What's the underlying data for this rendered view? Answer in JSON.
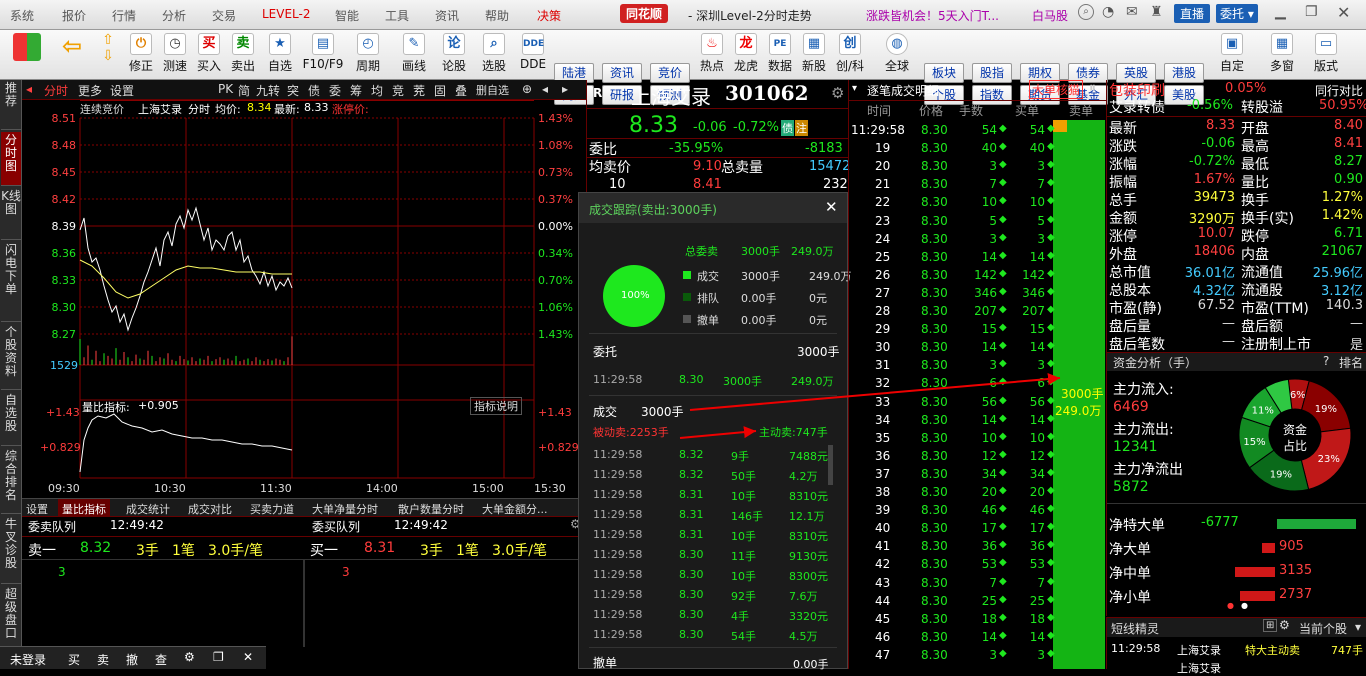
{
  "menubar": {
    "items": [
      "系统",
      "报价",
      "行情",
      "分析",
      "交易",
      "LEVEL-2",
      "智能",
      "工具",
      "资讯",
      "帮助",
      "决策"
    ],
    "logo": "同花顺",
    "title": "- 深圳Level-2分时走势",
    "promo": "涨跌皆机会！5天入门T...",
    "horse": "白马股",
    "btn_live": "直播",
    "btn_entrust": "委托"
  },
  "toolbar": {
    "buttons": [
      "修正",
      "测速",
      "买入",
      "卖出",
      "自选",
      "F10/F9",
      "周期",
      "画线",
      "论股",
      "选股",
      "DDE"
    ],
    "buttons2": [
      "热点",
      "龙虎",
      "数据",
      "新股",
      "创/科",
      "全球"
    ],
    "small_top": [
      "陆港",
      "资讯",
      "竞价"
    ],
    "small_bot": [
      "两融",
      "研报",
      "预测"
    ],
    "small2_top": [
      "板块",
      "股指",
      "期权",
      "债券",
      "英股",
      "港股"
    ],
    "small2_bot": [
      "个股",
      "指数",
      "期货",
      "基金",
      "外汇",
      "美股"
    ],
    "right": [
      "自定",
      "多窗",
      "版式"
    ]
  },
  "lefttabs": [
    "推荐",
    "分时图",
    "K线图",
    "闪电下单",
    "个股资料",
    "自选股",
    "综合排名",
    "牛叉诊股",
    "超级盘口"
  ],
  "chart": {
    "tabs": [
      "分时",
      "更多",
      "设置"
    ],
    "icons": [
      "PK",
      "简",
      "九转",
      "突",
      "债",
      "委",
      "筹",
      "均",
      "竞",
      "茺",
      "固",
      "叠",
      "删自选"
    ],
    "info": {
      "prefix": "连续竞价",
      "name": "上海艾录",
      "label_ptype": "分时",
      "avg_label": "均价:",
      "avg": "8.34",
      "latest_label": "最新:",
      "latest": "8.33",
      "limit": "涨停价:"
    },
    "y_left": [
      "8.51",
      "8.48",
      "8.45",
      "8.42",
      "8.39",
      "8.36",
      "8.33",
      "8.30",
      "8.27"
    ],
    "y_right": [
      "1.43%",
      "1.08%",
      "0.73%",
      "0.37%",
      "0.00%",
      "0.34%",
      "0.70%",
      "1.06%",
      "1.43%"
    ],
    "vol_label": "1529",
    "ratio_title": "量比指标:",
    "ratio_val": "+0.905",
    "ratio_help": "指标说明",
    "ratio_left": [
      "+1.43",
      "+0.829"
    ],
    "ratio_right": [
      "+1.43",
      "+0.829"
    ],
    "x_labels": [
      "09:30",
      "10:30",
      "11:30",
      "14:00",
      "15:00",
      "15:30"
    ],
    "bottom_tabs": [
      "设置",
      "量比指标",
      "成交统计",
      "成交对比",
      "买卖力道",
      "大单净量分时",
      "散户数量分时",
      "大单金额分..."
    ]
  },
  "queue": {
    "sell_title": "委卖队列",
    "sell_time": "12:49:42",
    "buy_title": "委买队列",
    "buy_time": "12:49:42",
    "sell": {
      "name": "卖一",
      "price": "8.32",
      "vol": "3手",
      "cnt": "1笔",
      "avg": "3.0手/笔",
      "item": "3"
    },
    "buy": {
      "name": "买一",
      "price": "8.31",
      "vol": "3手",
      "cnt": "1笔",
      "avg": "3.0手/笔",
      "item": "3"
    }
  },
  "statusbar": [
    "未登录",
    "买",
    "卖",
    "撤",
    "查"
  ],
  "quote": {
    "market": "R",
    "name": "上海艾录",
    "code": "301062",
    "price": "8.33",
    "change": "-0.06",
    "pct": "-0.72%",
    "tag1": "债",
    "tag2": "注",
    "wb_label": "委比",
    "wb": "-35.95%",
    "wc": "-8183",
    "avg_label": "均卖价",
    "avg": "9.10",
    "tot_label": "总卖量",
    "tot": "15472",
    "row_a": "10",
    "row_b": "8.41",
    "row_c": "232"
  },
  "popup": {
    "title": "成交跟踪(卖出:3000手)",
    "pie_label": "100%",
    "total_label": "总委卖",
    "total_vol": "3000手",
    "total_amt": "249.0万",
    "legend": [
      {
        "name": "成交",
        "vol": "3000手",
        "amt": "249.0万",
        "color": "#1ee81e"
      },
      {
        "name": "排队",
        "vol": "0.00手",
        "amt": "0元",
        "color": "#0a5a0a"
      },
      {
        "name": "撤单",
        "vol": "0.00手",
        "amt": "0元",
        "color": "#555555"
      }
    ],
    "entrust_label": "委托",
    "entrust_vol": "3000手",
    "entrust_row": {
      "time": "11:29:58",
      "price": "8.30",
      "vol": "3000手",
      "amt": "249.0万"
    },
    "deal_label": "成交",
    "deal_vol": "3000手",
    "passive": "被动卖:2253手",
    "active": "主动卖:747手",
    "rows": [
      {
        "time": "11:29:58",
        "price": "8.32",
        "vol": "9手",
        "amt": "7488元"
      },
      {
        "time": "11:29:58",
        "price": "8.32",
        "vol": "50手",
        "amt": "4.2万"
      },
      {
        "time": "11:29:58",
        "price": "8.31",
        "vol": "10手",
        "amt": "8310元"
      },
      {
        "time": "11:29:58",
        "price": "8.31",
        "vol": "146手",
        "amt": "12.1万"
      },
      {
        "time": "11:29:58",
        "price": "8.31",
        "vol": "10手",
        "amt": "8310元"
      },
      {
        "time": "11:29:58",
        "price": "8.30",
        "vol": "11手",
        "amt": "9130元"
      },
      {
        "time": "11:29:58",
        "price": "8.30",
        "vol": "10手",
        "amt": "8300元"
      },
      {
        "time": "11:29:58",
        "price": "8.30",
        "vol": "92手",
        "amt": "7.6万"
      },
      {
        "time": "11:29:58",
        "price": "8.30",
        "vol": "4手",
        "amt": "3320元"
      },
      {
        "time": "11:29:58",
        "price": "8.30",
        "vol": "54手",
        "amt": "4.5万"
      }
    ],
    "cancel_label": "撤单",
    "cancel_vol": "0.00手"
  },
  "ticks": {
    "title": "逐笔成交明细",
    "big_btn": "大单核猫",
    "headers": [
      "时间",
      "价格",
      "手数",
      "买单",
      "卖单"
    ],
    "first_time": "11:29:58",
    "rows": [
      {
        "t": "",
        "p": "8.30",
        "v": "54",
        "b": "54"
      },
      {
        "t": "19",
        "p": "8.30",
        "v": "40",
        "b": "40"
      },
      {
        "t": "20",
        "p": "8.30",
        "v": "3",
        "b": "3"
      },
      {
        "t": "21",
        "p": "8.30",
        "v": "7",
        "b": "7"
      },
      {
        "t": "22",
        "p": "8.30",
        "v": "10",
        "b": "10"
      },
      {
        "t": "23",
        "p": "8.30",
        "v": "5",
        "b": "5"
      },
      {
        "t": "24",
        "p": "8.30",
        "v": "3",
        "b": "3"
      },
      {
        "t": "25",
        "p": "8.30",
        "v": "14",
        "b": "14"
      },
      {
        "t": "26",
        "p": "8.30",
        "v": "142",
        "b": "142"
      },
      {
        "t": "27",
        "p": "8.30",
        "v": "346",
        "b": "346"
      },
      {
        "t": "28",
        "p": "8.30",
        "v": "207",
        "b": "207"
      },
      {
        "t": "29",
        "p": "8.30",
        "v": "15",
        "b": "15"
      },
      {
        "t": "30",
        "p": "8.30",
        "v": "14",
        "b": "14"
      },
      {
        "t": "31",
        "p": "8.30",
        "v": "3",
        "b": "3"
      },
      {
        "t": "32",
        "p": "8.30",
        "v": "6",
        "b": "6"
      },
      {
        "t": "33",
        "p": "8.30",
        "v": "56",
        "b": "56"
      },
      {
        "t": "34",
        "p": "8.30",
        "v": "14",
        "b": "14"
      },
      {
        "t": "35",
        "p": "8.30",
        "v": "10",
        "b": "10"
      },
      {
        "t": "36",
        "p": "8.30",
        "v": "12",
        "b": "12"
      },
      {
        "t": "37",
        "p": "8.30",
        "v": "34",
        "b": "34"
      },
      {
        "t": "38",
        "p": "8.30",
        "v": "20",
        "b": "20"
      },
      {
        "t": "39",
        "p": "8.30",
        "v": "46",
        "b": "46"
      },
      {
        "t": "40",
        "p": "8.30",
        "v": "17",
        "b": "17"
      },
      {
        "t": "41",
        "p": "8.30",
        "v": "36",
        "b": "36"
      },
      {
        "t": "42",
        "p": "8.30",
        "v": "53",
        "b": "53"
      },
      {
        "t": "43",
        "p": "8.30",
        "v": "7",
        "b": "7"
      },
      {
        "t": "44",
        "p": "8.30",
        "v": "25",
        "b": "25"
      },
      {
        "t": "45",
        "p": "8.30",
        "v": "18",
        "b": "18"
      },
      {
        "t": "46",
        "p": "8.30",
        "v": "14",
        "b": "14"
      },
      {
        "t": "47",
        "p": "8.30",
        "v": "3",
        "b": "3"
      }
    ],
    "sell_block_vol": "3000手",
    "sell_block_amt": "249.0万"
  },
  "stats": {
    "header": [
      [
        "包装印刷",
        "0.05%",
        "同行对比"
      ],
      [
        "艾录转债",
        "-0.56%",
        "转股溢",
        "50.95%"
      ]
    ],
    "rows": [
      [
        "最新",
        "8.33",
        "开盘",
        "8.40"
      ],
      [
        "涨跌",
        "-0.06",
        "最高",
        "8.41"
      ],
      [
        "涨幅",
        "-0.72%",
        "最低",
        "8.27"
      ],
      [
        "振幅",
        "1.67%",
        "量比",
        "0.90"
      ],
      [
        "总手",
        "39473",
        "换手",
        "1.27%"
      ],
      [
        "金额",
        "3290万",
        "换手(实)",
        "1.42%"
      ],
      [
        "涨停",
        "10.07",
        "跌停",
        "6.71"
      ],
      [
        "外盘",
        "18406",
        "内盘",
        "21067"
      ],
      [
        "总市值",
        "36.01亿",
        "流通值",
        "25.96亿"
      ],
      [
        "总股本",
        "4.32亿",
        "流通股",
        "3.12亿"
      ],
      [
        "市盈(静)",
        "67.52",
        "市盈(TTM)",
        "140.3"
      ],
      [
        "盘后量",
        "—",
        "盘后额",
        "—"
      ],
      [
        "盘后笔数",
        "—",
        "注册制上市",
        "是"
      ]
    ]
  },
  "fund": {
    "title": "资金分析（手）",
    "help": "?",
    "rank": "排名",
    "inflow_label": "主力流入:",
    "inflow": "6469",
    "outflow_label": "主力流出:",
    "outflow": "12341",
    "net_label": "主力净流出",
    "net": "5872",
    "donut_center": [
      "资金",
      "占比"
    ],
    "slices": [
      {
        "label": "6%",
        "value": 6,
        "color": "#b01010"
      },
      {
        "label": "19%",
        "value": 19,
        "color": "#8a0000"
      },
      {
        "label": "23%",
        "value": 23,
        "color": "#c01818"
      },
      {
        "label": "19%",
        "value": 19,
        "color": "#0a6a1a"
      },
      {
        "label": "15%",
        "value": 15,
        "color": "#128a22"
      },
      {
        "label": "11%",
        "value": 11,
        "color": "#1aa52e"
      },
      {
        "label": "",
        "value": 7,
        "color": "#2fc843"
      }
    ],
    "bars": [
      {
        "name": "净特大单",
        "val": "-6777",
        "pct": 0.9,
        "color": "#1ea83a"
      },
      {
        "name": "净大单",
        "val": "905",
        "pct": 0.15,
        "color": "#d01818"
      },
      {
        "name": "净中单",
        "val": "3135",
        "pct": 0.45,
        "color": "#d01818"
      },
      {
        "name": "净小单",
        "val": "2737",
        "pct": 0.4,
        "color": "#d01818"
      }
    ]
  },
  "sprite": {
    "title": "短线精灵",
    "mode": "当前个股",
    "rows": [
      {
        "time": "11:29:58",
        "name": "上海艾录",
        "type": "特大主动卖",
        "vol": "747手"
      }
    ]
  }
}
